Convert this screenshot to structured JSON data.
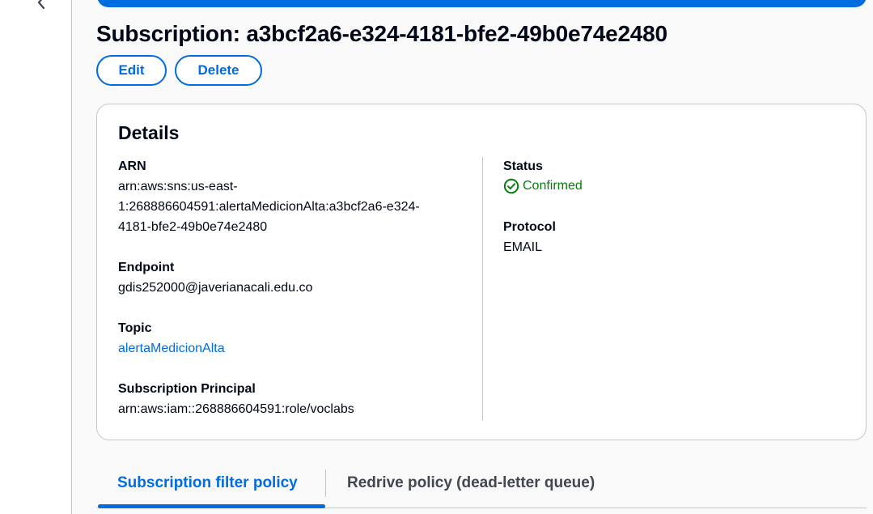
{
  "page": {
    "title": "Subscription: a3bcf2a6-e324-4181-bfe2-49b0e74e2480"
  },
  "actions": {
    "edit_label": "Edit",
    "delete_label": "Delete"
  },
  "details": {
    "title": "Details",
    "arn_label": "ARN",
    "arn_line1": "arn:aws:sns:us-east-",
    "arn_line2": "1:268886604591:alertaMedicionAlta:a3bcf2a6-e324-",
    "arn_line3": "4181-bfe2-49b0e74e2480",
    "endpoint_label": "Endpoint",
    "endpoint_value": "gdis252000@javerianacali.edu.co",
    "topic_label": "Topic",
    "topic_value": "alertaMedicionAlta",
    "principal_label": "Subscription Principal",
    "principal_value": "arn:aws:iam::268886604591:role/voclabs",
    "status_label": "Status",
    "status_value": "Confirmed",
    "protocol_label": "Protocol",
    "protocol_value": "EMAIL"
  },
  "tabs": [
    {
      "label": "Subscription filter policy",
      "active": true
    },
    {
      "label": "Redrive policy (dead-letter queue)",
      "active": false
    }
  ],
  "icons": {
    "back": "chevron-left-icon",
    "status": "check-circle-icon"
  },
  "colors": {
    "accent": "#006ce0",
    "success": "#037f0c",
    "text": "#000716",
    "border": "#c6c6cd"
  }
}
